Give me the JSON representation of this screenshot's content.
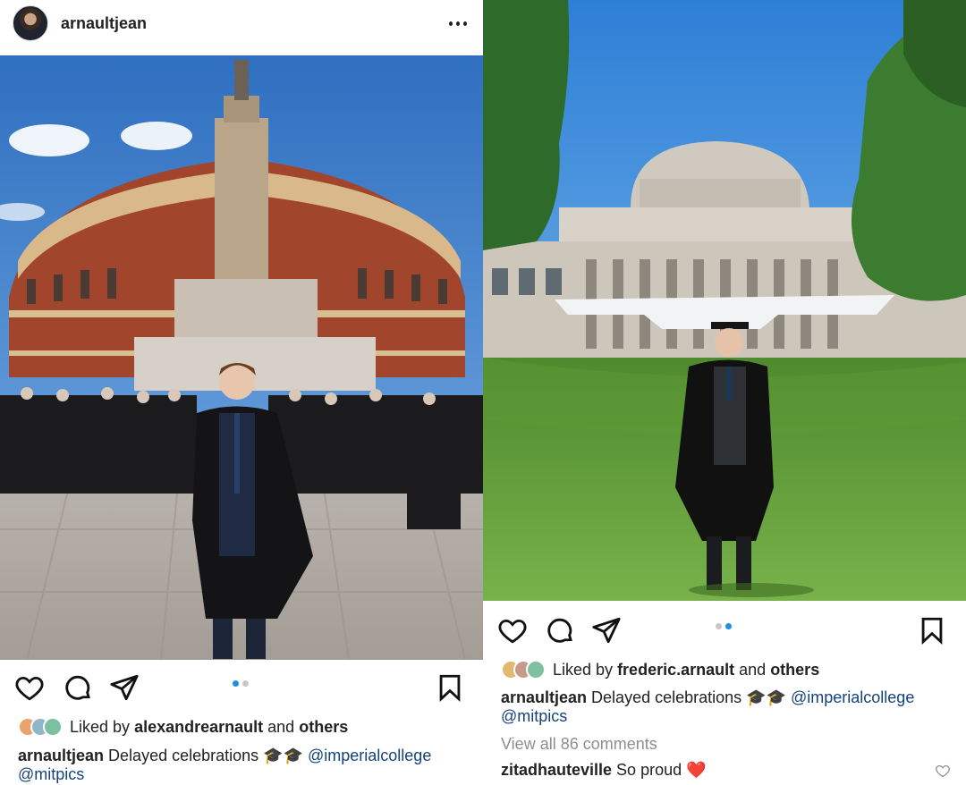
{
  "left_post": {
    "username": "arnaultjean",
    "carousel": {
      "index": 1,
      "total": 2
    },
    "liked_by_prefix": "Liked by",
    "liked_by_user": "alexandrearnault",
    "liked_by_suffix": "and",
    "liked_by_others": "others",
    "caption_user": "arnaultjean",
    "caption_text": "Delayed celebrations 🎓🎓",
    "mention_1": "@imperialcollege",
    "mention_2": "@mitpics"
  },
  "right_post": {
    "carousel": {
      "index": 2,
      "total": 2
    },
    "liked_by_prefix": "Liked by",
    "liked_by_user": "frederic.arnault",
    "liked_by_suffix": "and",
    "liked_by_others": "others",
    "caption_user": "arnaultjean",
    "caption_text": "Delayed celebrations 🎓🎓",
    "mention_1": "@imperialcollege",
    "mention_2": "@mitpics",
    "view_comments": "View all 86 comments",
    "comment_user": "zitadhauteville",
    "comment_text": "So proud",
    "comment_emoji": "❤️"
  },
  "icons": [
    "more-icon",
    "heart-icon",
    "comment-icon",
    "share-icon",
    "bookmark-icon"
  ],
  "colors": {
    "accent_dot": "#1f8fe3",
    "link": "#13437a",
    "muted": "#8e8e8e",
    "heart_red": "#e0242c"
  }
}
